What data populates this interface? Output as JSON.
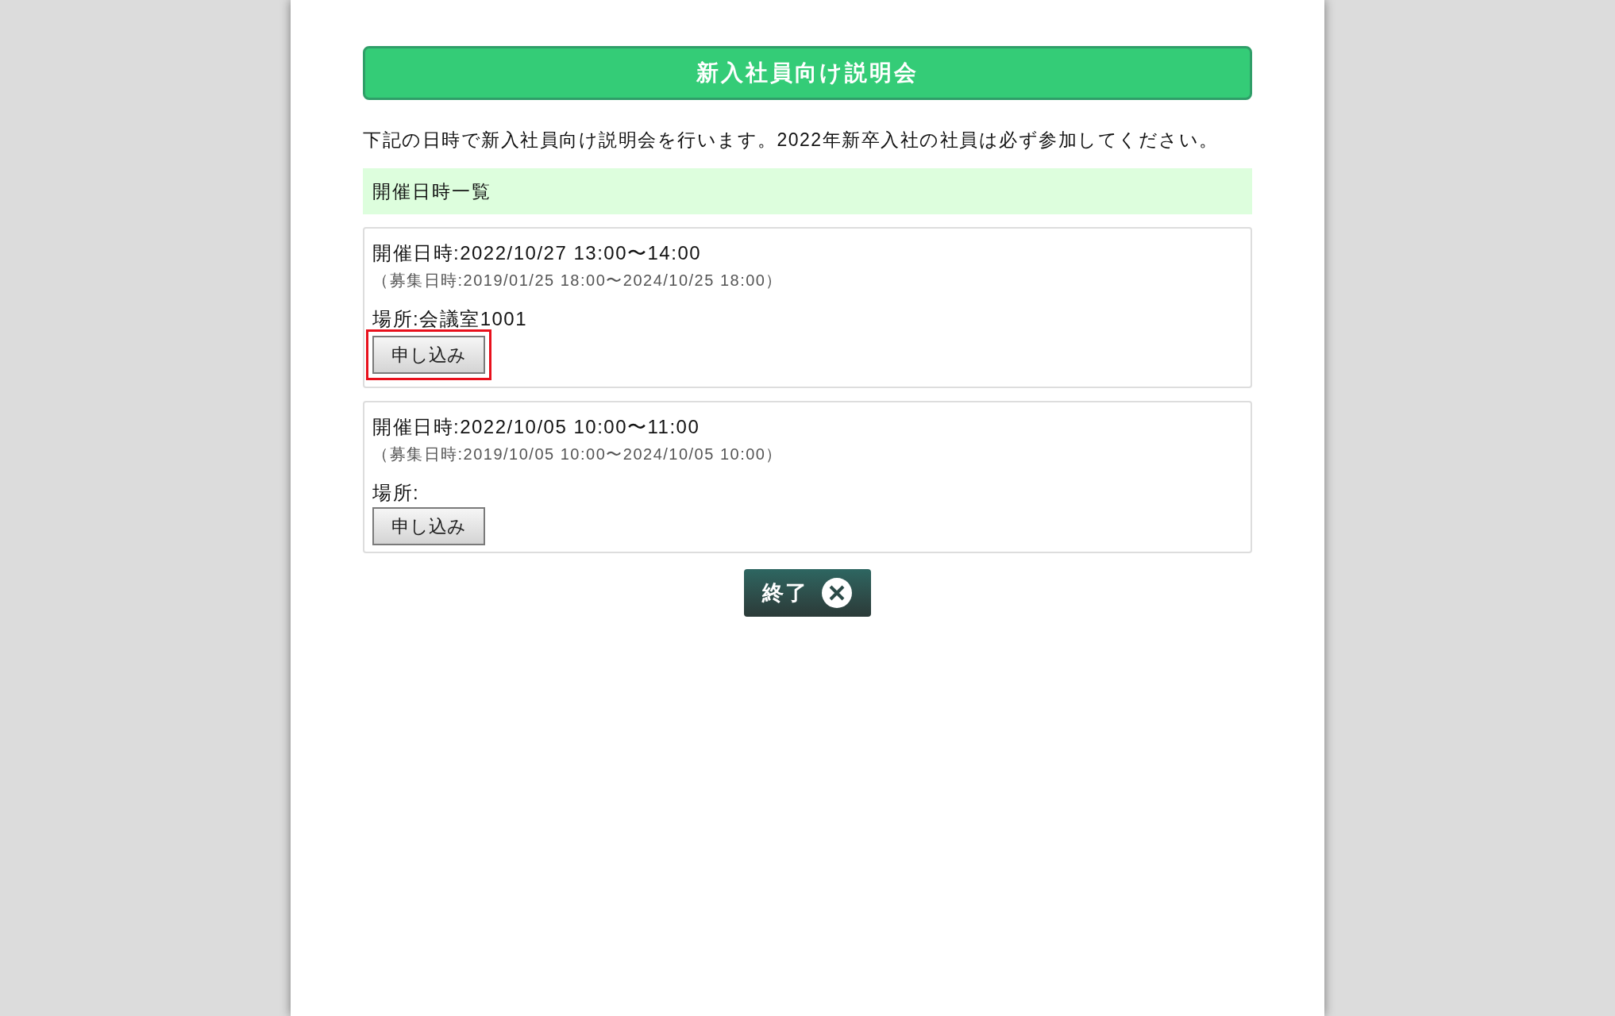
{
  "header": {
    "title": "新入社員向け説明会"
  },
  "intro": "下記の日時で新入社員向け説明会を行います。2022年新卒入社の社員は必ず参加してください。",
  "section": {
    "title": "開催日時一覧"
  },
  "sessions": [
    {
      "datetime": "開催日時:2022/10/27 13:00〜14:00",
      "recruitment": "（募集日時:2019/01/25 18:00〜2024/10/25 18:00）",
      "place": "場所:会議室1001",
      "button": "申し込み",
      "highlighted": true
    },
    {
      "datetime": "開催日時:2022/10/05 10:00〜11:00",
      "recruitment": "（募集日時:2019/10/05 10:00〜2024/10/05 10:00）",
      "place": "場所:",
      "button": "申し込み",
      "highlighted": false
    }
  ],
  "close_button": {
    "label": "終了"
  }
}
